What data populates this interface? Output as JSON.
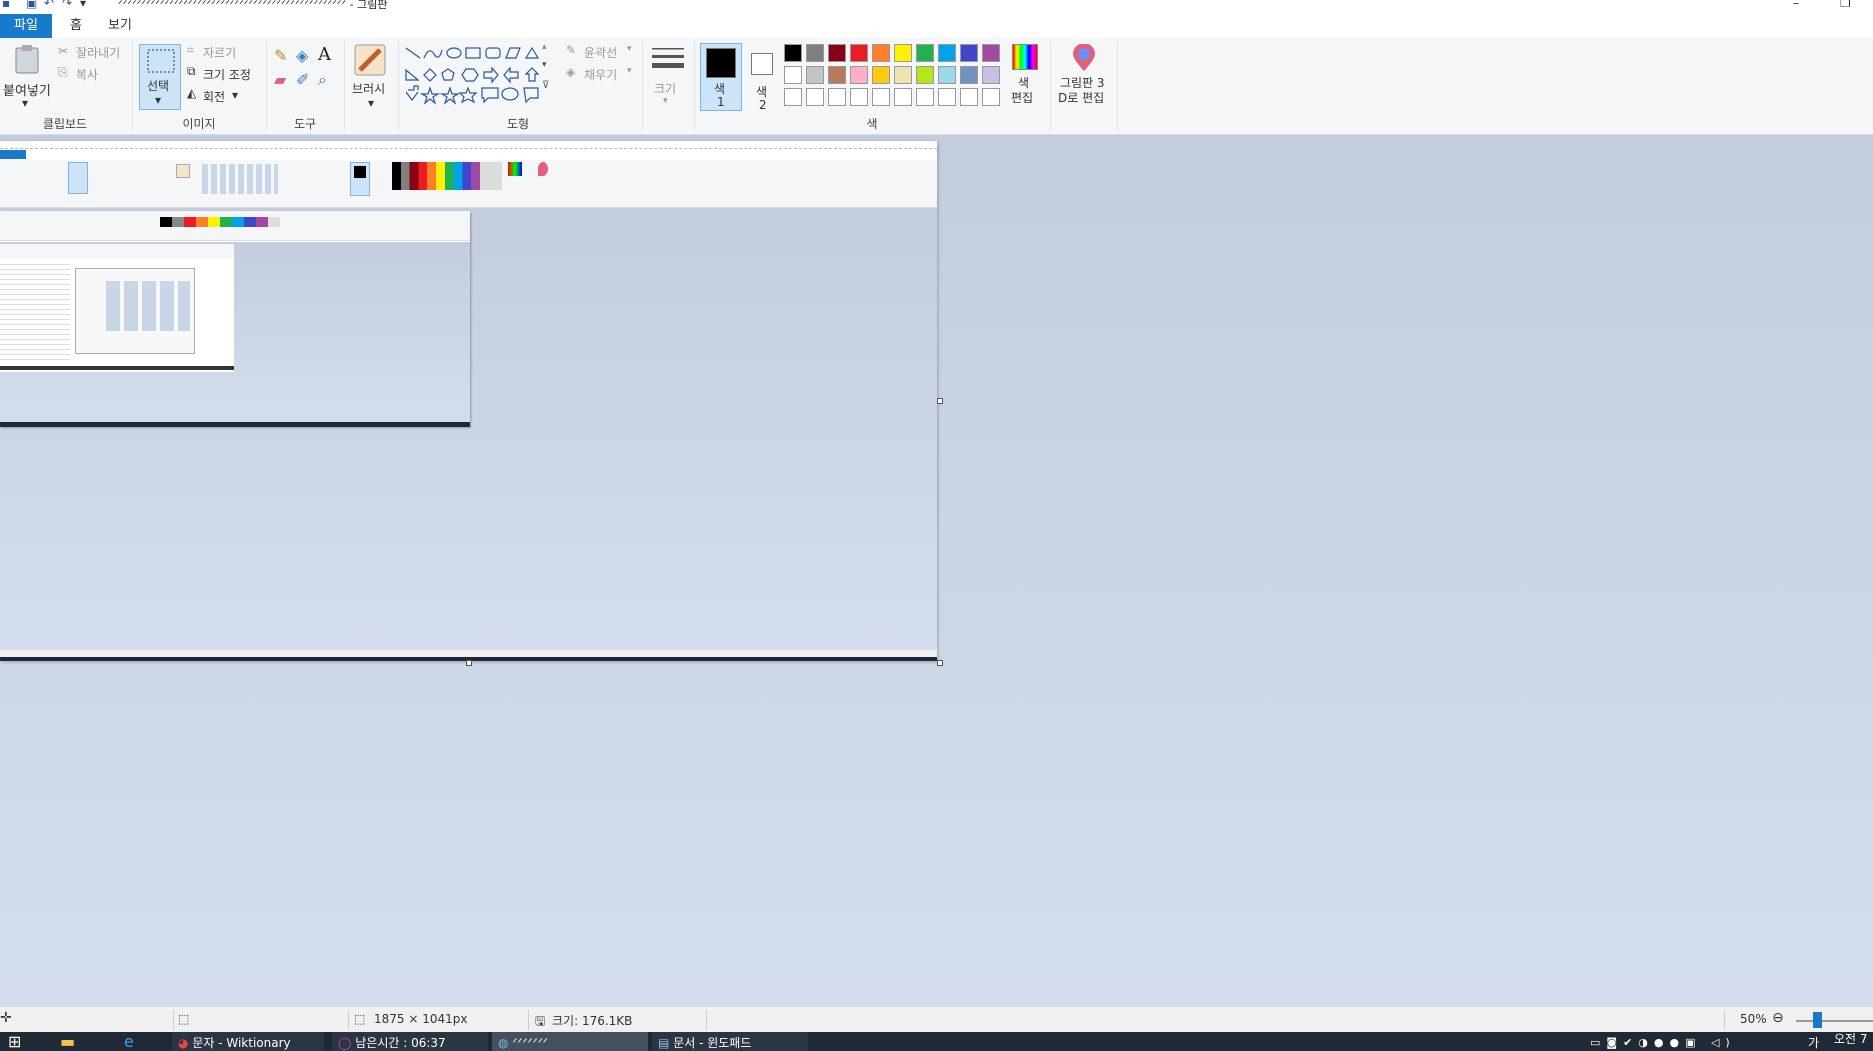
{
  "window": {
    "title": "ᐟᐟᐟᐟᐟᐟᐟᐟᐟᐟᐟᐟᐟᐟᐟᐟᐟᐟᐟᐟᐟᐟᐟᐟᐟᐟᐟᐟᐟᐟᐟᐟᐟᐟᐟᐟᐟᐟᐟᐟᐟᐟᐟᐟᐟᐟᐟᐟᐟ - 그림판"
  },
  "menu": {
    "file": "파일",
    "home": "홈",
    "view": "보기"
  },
  "ribbon": {
    "clipboard": {
      "paste": "붙여넣기",
      "cut": "잘라내기",
      "copy": "복사",
      "label": "클립보드"
    },
    "image": {
      "select": "선택",
      "crop": "자르기",
      "resize": "크기 조정",
      "rotate": "회전",
      "label": "이미지"
    },
    "tools": {
      "label": "도구"
    },
    "brushes": {
      "label": "브러시"
    },
    "shapes": {
      "outline": "윤곽선",
      "fill": "채우기",
      "label": "도형"
    },
    "size": {
      "label": "크기"
    },
    "colors": {
      "color1": "색",
      "color1_num": "1",
      "color2": "색",
      "color2_num": "2",
      "edit_top": "색",
      "edit_bottom": "편집",
      "label": "색",
      "palette_row1": [
        "#000000",
        "#7f7f7f",
        "#880015",
        "#ed1c24",
        "#ff7f27",
        "#fff200",
        "#22b14c",
        "#00a2e8",
        "#3f48cc",
        "#a349a4"
      ],
      "palette_row2": [
        "#ffffff",
        "#c3c3c3",
        "#b97a57",
        "#ffaec9",
        "#ffc90e",
        "#efe4b0",
        "#b5e61d",
        "#99d9ea",
        "#7092be",
        "#c8bfe7"
      ]
    },
    "paint3d": {
      "line1": "그림판 3",
      "line2": "D로 편집"
    }
  },
  "status": {
    "dimensions": "1875 × 1041px",
    "size": "크기: 176.1KB",
    "zoom": "50%"
  },
  "taskbar": {
    "chrome": "문자 - Wiktionary",
    "timer": "남은시간 : 06:37",
    "paint": "ᐟᐟᐟᐟᐟᐟᐟ",
    "notepad": "문서 - 윈도패드",
    "lang": "가",
    "clock": "오전 7"
  }
}
